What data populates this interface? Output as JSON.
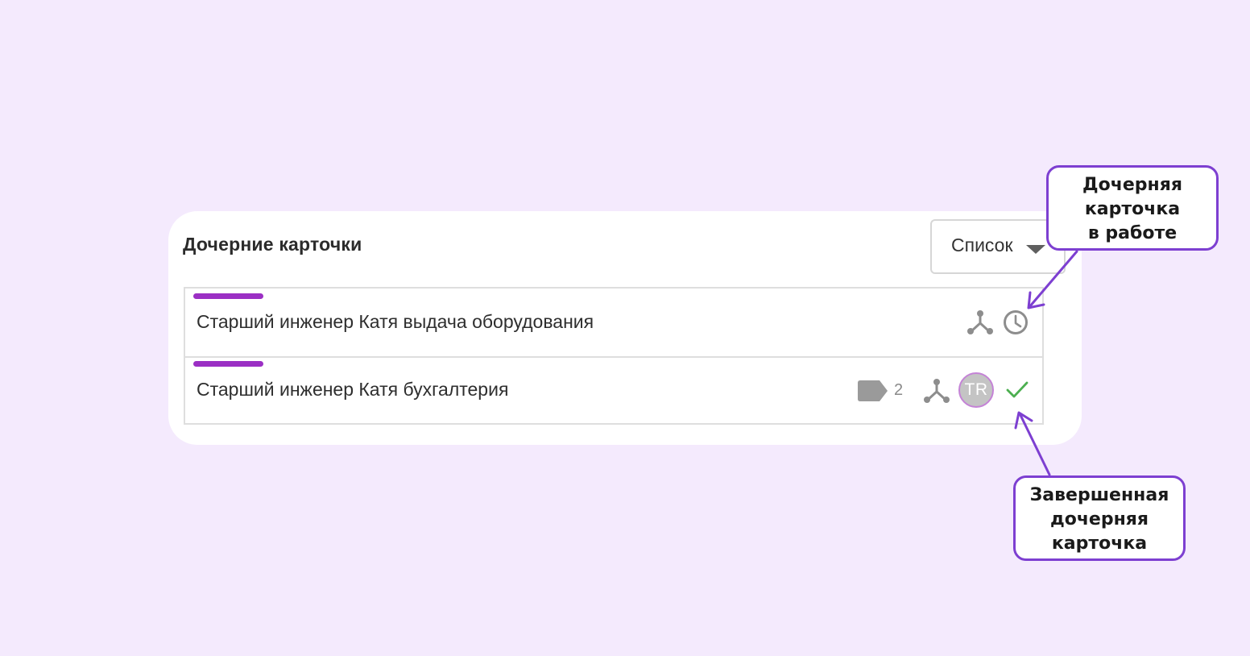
{
  "panel": {
    "title": "Дочерние карточки",
    "view_select": {
      "selected": "Список"
    }
  },
  "cards": [
    {
      "title": "Старший инженер Катя выдача оборудования",
      "stripe_color": "#9b2fc4",
      "icons": [
        "subtasks-icon",
        "clock-icon"
      ],
      "status": "in-progress"
    },
    {
      "title": "Старший инженер Катя бухгалтерия",
      "stripe_color": "#9b2fc4",
      "tag_count": "2",
      "avatar_initials": "TR",
      "icons": [
        "tag-icon",
        "subtasks-icon",
        "avatar",
        "check-icon"
      ],
      "status": "done"
    }
  ],
  "annotations": {
    "in_progress": {
      "lines": [
        "Дочерняя",
        "карточка",
        "в работе"
      ]
    },
    "done": {
      "lines": [
        "Завершенная",
        "дочерняя",
        "карточка"
      ]
    },
    "accent_color": "#7d3fd1"
  },
  "colors": {
    "background": "#f4eafd",
    "icon_gray": "#8d8d8d",
    "check_green": "#4caf50"
  }
}
